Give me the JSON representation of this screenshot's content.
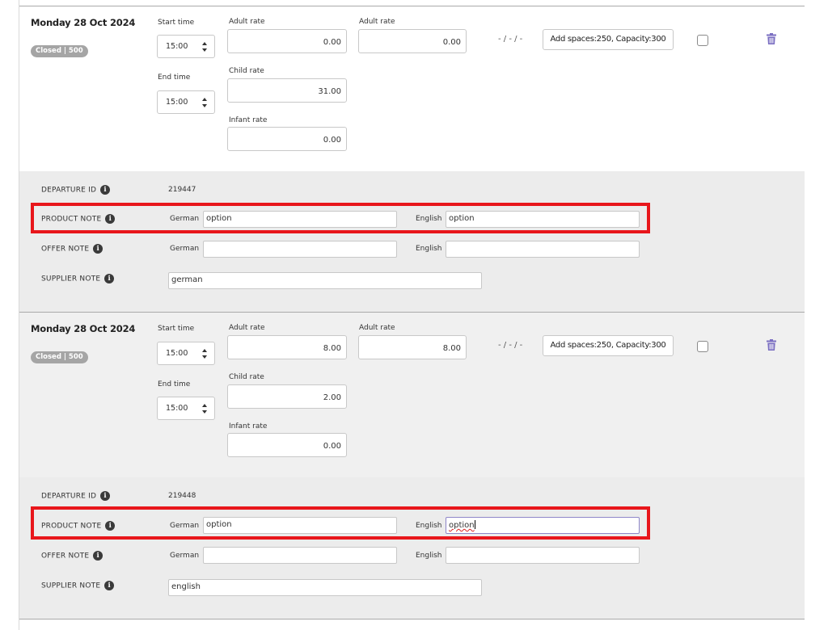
{
  "departures": [
    {
      "date": "Monday 28 Oct 2024",
      "status_badge": "Closed | 500",
      "start_time_label": "Start time",
      "start_time": "15:00",
      "end_time_label": "End time",
      "end_time": "15:00",
      "adult_rate_label": "Adult rate",
      "adult_rate": "0.00",
      "adult_rate2_label": "Adult rate",
      "adult_rate2": "0.00",
      "child_rate_label": "Child rate",
      "child_rate": "31.00",
      "infant_rate_label": "Infant rate",
      "infant_rate": "0.00",
      "dashes": "- / - / -",
      "capacity_button": "Add spaces:250, Capacity:300",
      "departure_id_label": "DEPARTURE ID",
      "departure_id": "219447",
      "product_note_label": "PRODUCT NOTE",
      "product_note_german_label": "German",
      "product_note_german": "option",
      "product_note_english_label": "English",
      "product_note_english": "option",
      "offer_note_label": "OFFER NOTE",
      "offer_note_german_label": "German",
      "offer_note_german": "",
      "offer_note_english_label": "English",
      "offer_note_english": "",
      "supplier_note_label": "SUPPLIER NOTE",
      "supplier_note": "german"
    },
    {
      "date": "Monday 28 Oct 2024",
      "status_badge": "Closed | 500",
      "start_time_label": "Start time",
      "start_time": "15:00",
      "end_time_label": "End time",
      "end_time": "15:00",
      "adult_rate_label": "Adult rate",
      "adult_rate": "8.00",
      "adult_rate2_label": "Adult rate",
      "adult_rate2": "8.00",
      "child_rate_label": "Child rate",
      "child_rate": "2.00",
      "infant_rate_label": "Infant rate",
      "infant_rate": "0.00",
      "dashes": "- / - / -",
      "capacity_button": "Add spaces:250, Capacity:300",
      "departure_id_label": "DEPARTURE ID",
      "departure_id": "219448",
      "product_note_label": "PRODUCT NOTE",
      "product_note_german_label": "German",
      "product_note_german": "option",
      "product_note_english_label": "English",
      "product_note_english": "option",
      "offer_note_label": "OFFER NOTE",
      "offer_note_german_label": "German",
      "offer_note_german": "",
      "offer_note_english_label": "English",
      "offer_note_english": "",
      "supplier_note_label": "SUPPLIER NOTE",
      "supplier_note": "english"
    }
  ],
  "colors": {
    "highlight_border": "#e8161b",
    "badge_bg": "#a5a5a5",
    "trash_icon": "#7b6fc2",
    "grey_panel": "#ececec"
  }
}
